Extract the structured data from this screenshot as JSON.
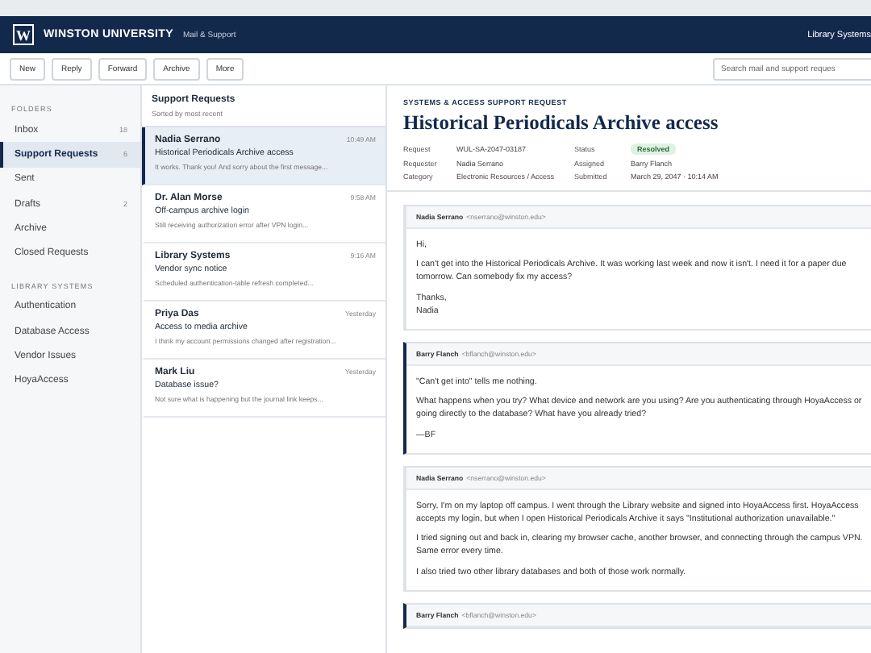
{
  "header": {
    "logo": "W",
    "org": "WINSTON UNIVERSITY",
    "app": "Mail & Support",
    "account": "Library Systems"
  },
  "toolbar": {
    "buttons": [
      "New",
      "Reply",
      "Forward",
      "Archive",
      "More"
    ],
    "search": {
      "placeholder": "Search mail and support reques"
    }
  },
  "sidebar": {
    "sections": [
      {
        "title": "FOLDERS",
        "items": [
          {
            "label": "Inbox",
            "count": "18",
            "selected": false
          },
          {
            "label": "Support Requests",
            "count": "6",
            "selected": true
          },
          {
            "label": "Sent",
            "selected": false
          },
          {
            "label": "Drafts",
            "count": "2",
            "selected": false
          },
          {
            "label": "Archive",
            "selected": false
          },
          {
            "label": "Closed Requests",
            "selected": false
          }
        ]
      },
      {
        "title": "LIBRARY SYSTEMS",
        "items": [
          {
            "label": "Authentication",
            "selected": false
          },
          {
            "label": "Database Access",
            "selected": false
          },
          {
            "label": "Vendor Issues",
            "selected": false
          },
          {
            "label": "HoyaAccess",
            "selected": false
          }
        ]
      }
    ]
  },
  "message_list": {
    "title": "Support Requests",
    "subtitle": "Sorted by most recent",
    "items": [
      {
        "sender": "Nadia Serrano",
        "time": "10:49 AM",
        "subject": "Historical Periodicals Archive access",
        "preview": "It works. Thank you! And sorry about the first message...",
        "selected": true
      },
      {
        "sender": "Dr. Alan Morse",
        "time": "9:58 AM",
        "subject": "Off-campus archive login",
        "preview": "Still receiving authorization error after VPN login...",
        "selected": false
      },
      {
        "sender": "Library Systems",
        "time": "9:16 AM",
        "subject": "Vendor sync notice",
        "preview": "Scheduled authentication-table refresh completed...",
        "selected": false
      },
      {
        "sender": "Priya Das",
        "time": "Yesterday",
        "subject": "Access to media archive",
        "preview": "I think my account permissions changed after registration...",
        "selected": false
      },
      {
        "sender": "Mark Liu",
        "time": "Yesterday",
        "subject": "Database issue?",
        "preview": "Not sure what is happening but the journal link keeps...",
        "selected": false
      }
    ]
  },
  "detail": {
    "eyebrow": "SYSTEMS & ACCESS SUPPORT REQUEST",
    "title": "Historical Periodicals Archive access",
    "meta": [
      {
        "label": "Request",
        "value": "WUL-SA-2047-03187"
      },
      {
        "label": "Status",
        "value": "Resolved",
        "kind": "badge"
      },
      {
        "label": "Requester",
        "value": "Nadia Serrano"
      },
      {
        "label": "Assigned",
        "value": "Barry Flanch"
      },
      {
        "label": "Category",
        "value": "Electronic Resources / Access"
      },
      {
        "label": "Submitted",
        "value": "March 29, 2047 · 10:14 AM"
      }
    ],
    "thread": [
      {
        "kind": "requester",
        "sender": "Nadia Serrano",
        "email": "<nserrano@winston.edu>",
        "paragraphs": [
          "Hi,",
          "I can't get into the Historical Periodicals Archive. It was working last week and now it isn't. I need it for a paper due tomorrow. Can somebody fix my access?",
          "Thanks,\nNadia"
        ]
      },
      {
        "kind": "staff",
        "sender": "Barry Flanch",
        "email": "<bflanch@winston.edu>",
        "paragraphs": [
          "\"Can't get into\" tells me nothing.",
          "What happens when you try? What device and network are you using? Are you authenticating through HoyaAccess or going directly to the database? What have you already tried?",
          "—BF"
        ]
      },
      {
        "kind": "requester",
        "sender": "Nadia Serrano",
        "email": "<nserrano@winston.edu>",
        "paragraphs": [
          "Sorry, I'm on my laptop off campus. I went through the Library website and signed into HoyaAccess first. HoyaAccess accepts my login, but when I open Historical Periodicals Archive it says \"Institutional authorization unavailable.\"",
          "I tried signing out and back in, clearing my browser cache, another browser, and connecting through the campus VPN. Same error every time.",
          "I also tried two other library databases and both of those work normally."
        ]
      },
      {
        "kind": "staff",
        "sender": "Barry Flanch",
        "email": "<bflanch@winston.edu>"
      }
    ]
  }
}
